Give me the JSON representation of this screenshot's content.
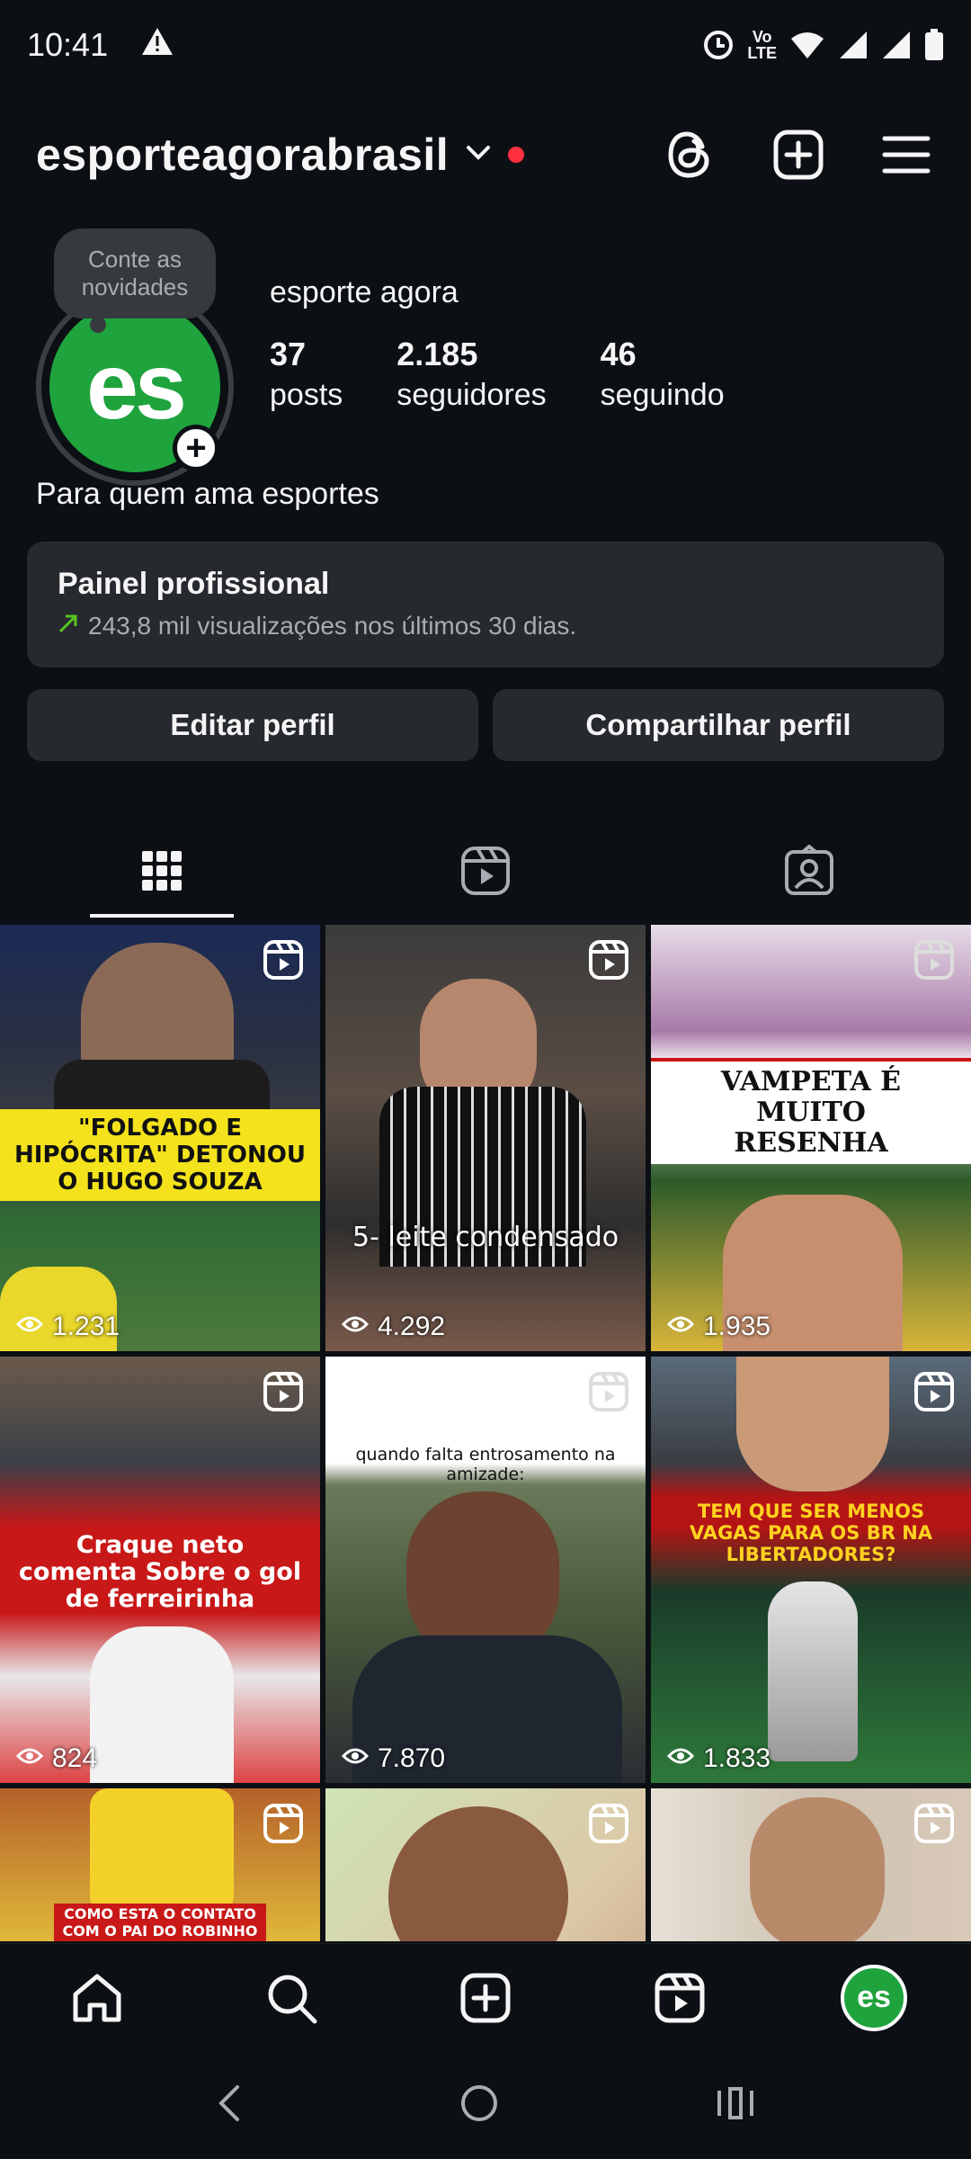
{
  "status_bar": {
    "time": "10:41",
    "network_line1": "Vo",
    "network_line2": "LTE"
  },
  "header": {
    "username": "esporteagorabrasil"
  },
  "profile": {
    "note_line1": "Conte as",
    "note_line2": "novidades",
    "avatar_text": "es",
    "display_name": "esporte agora",
    "stats": [
      {
        "value": "37",
        "label": "posts"
      },
      {
        "value": "2.185",
        "label": "seguidores"
      },
      {
        "value": "46",
        "label": "seguindo"
      }
    ],
    "bio": "Para quem ama esportes"
  },
  "pro_panel": {
    "title": "Painel profissional",
    "subtitle": "243,8 mil visualizações nos últimos 30 dias."
  },
  "buttons": {
    "edit": "Editar perfil",
    "share": "Compartilhar perfil"
  },
  "posts": [
    {
      "views": "1.231",
      "caption": "\"FOLGADO E HIPÓCRITA\" DETONOU O HUGO SOUZA"
    },
    {
      "views": "4.292",
      "caption": "5- leite condensado"
    },
    {
      "views": "1.935",
      "caption": "VAMPETA É MUITO RESENHA"
    },
    {
      "views": "824",
      "caption": "Craque neto comenta Sobre o gol de ferreirinha"
    },
    {
      "views": "7.870",
      "caption": "quando falta entrosamento na amizade:"
    },
    {
      "views": "1.833",
      "caption": "TEM QUE SER MENOS VAGAS PARA OS BR NA LIBERTADORES?"
    },
    {
      "views": "",
      "caption": "COMO ESTA O CONTATO COM O PAI DO ROBINHO JR"
    },
    {
      "views": "",
      "caption": ""
    },
    {
      "views": "",
      "caption": ""
    }
  ],
  "bottom_nav": {
    "avatar_text": "es"
  },
  "colors": {
    "background": "#0c1014",
    "surface": "#26292e",
    "accent_red": "#ff3040",
    "avatar_green": "#1fa33d",
    "trend_green": "#58c322"
  }
}
